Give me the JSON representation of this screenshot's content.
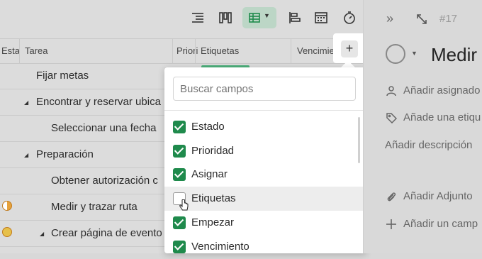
{
  "toolbar": {
    "icons": [
      "list-view-icon",
      "board-view-icon",
      "table-view-icon",
      "gantt-view-icon",
      "calendar-view-icon",
      "timer-icon"
    ]
  },
  "table": {
    "headers": [
      "Esta",
      "Tarea",
      "Priori",
      "Etiquetas",
      "Vencimier"
    ],
    "rows": [
      {
        "task": "Fijar metas"
      },
      {
        "task": "Encontrar y reservar ubica"
      },
      {
        "task": "Seleccionar una fecha"
      },
      {
        "task": "Preparación"
      },
      {
        "task": "Obtener autorización c"
      },
      {
        "task": "Medir y trazar ruta"
      },
      {
        "task": "Crear página de evento"
      }
    ]
  },
  "add_column_button": "+",
  "fields_popup": {
    "search_placeholder": "Buscar campos",
    "options": [
      {
        "label": "Estado",
        "checked": true
      },
      {
        "label": "Prioridad",
        "checked": true
      },
      {
        "label": "Asignar",
        "checked": true
      },
      {
        "label": "Etiquetas",
        "checked": false
      },
      {
        "label": "Empezar",
        "checked": true
      },
      {
        "label": "Vencimiento",
        "checked": true
      }
    ]
  },
  "detail_panel": {
    "task_id": "#17",
    "title": "Medir",
    "assignee": "Añadir asignado",
    "tag": "Añade una etiqu",
    "description": "Añadir descripción",
    "attachment": "Añadir Adjunto",
    "add_field": "Añadir un camp"
  },
  "colors": {
    "accent_green": "#1f8a4c",
    "status_orange": "#c07a1c"
  }
}
